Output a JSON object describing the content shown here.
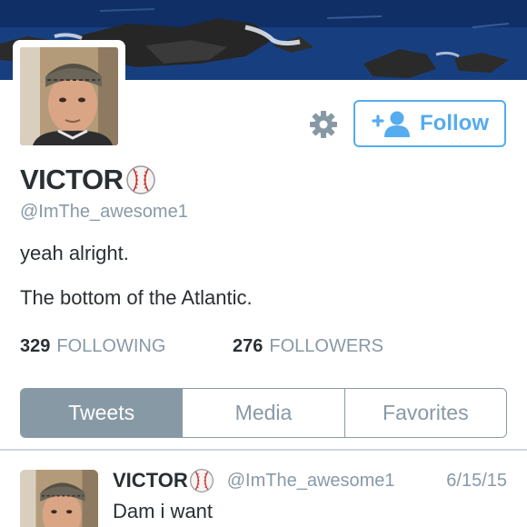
{
  "profile": {
    "name": "VICTOR",
    "handle": "@ImThe_awesome1",
    "bio": "yeah alright.",
    "location": "The bottom of the Atlantic.",
    "name_emoji": "baseball-icon"
  },
  "actions": {
    "settings_icon": "gear-icon",
    "follow_label": "Follow",
    "follow_icon": "add-user-icon"
  },
  "stats": {
    "following_count": "329",
    "following_label": "FOLLOWING",
    "followers_count": "276",
    "followers_label": "FOLLOWERS"
  },
  "tabs": [
    {
      "label": "Tweets",
      "active": true
    },
    {
      "label": "Media",
      "active": false
    },
    {
      "label": "Favorites",
      "active": false
    }
  ],
  "tweets": [
    {
      "name": "VICTOR",
      "handle": "@ImThe_awesome1",
      "date": "6/15/15",
      "text": "Dam i want"
    }
  ],
  "colors": {
    "accent": "#55acee",
    "muted": "#8899a6",
    "text": "#292f33"
  }
}
